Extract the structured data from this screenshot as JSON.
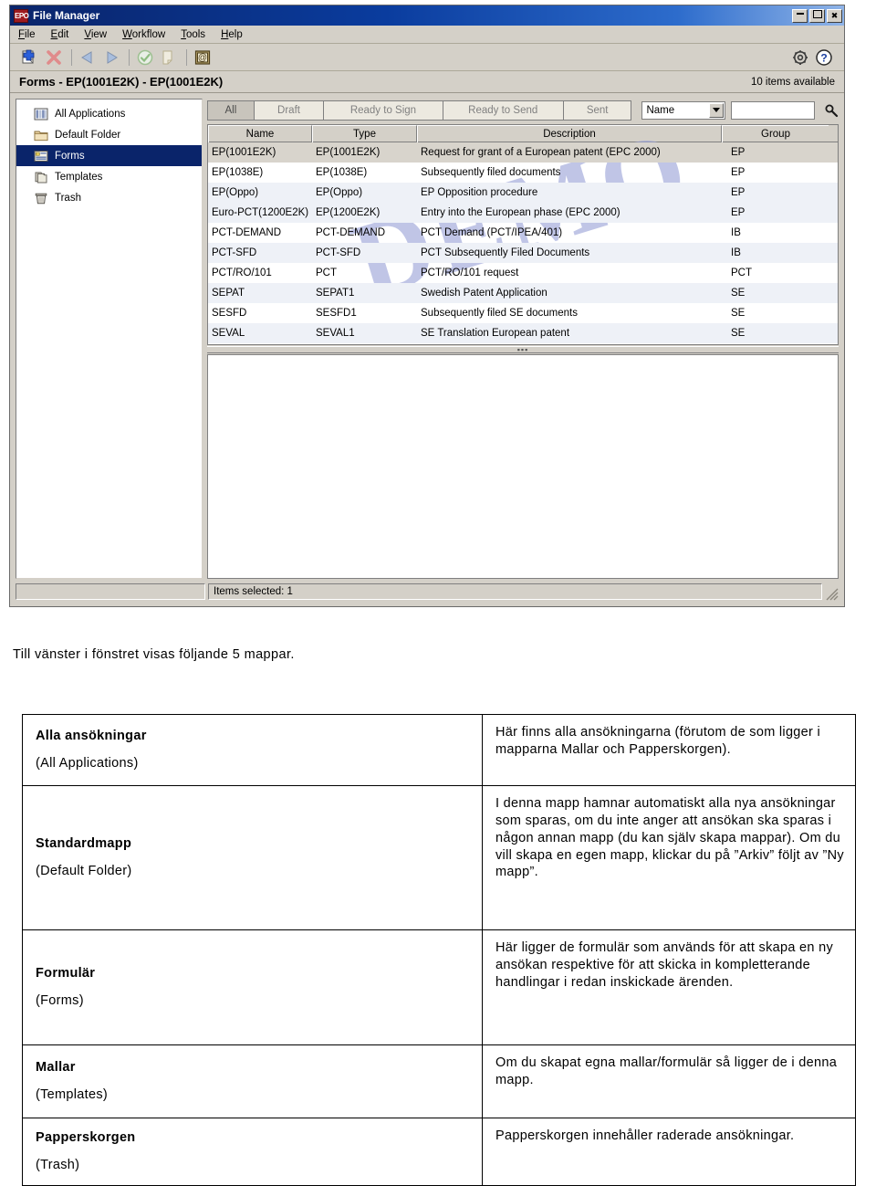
{
  "window": {
    "app_icon_label": "EPO",
    "title": "File Manager",
    "controls": {
      "minimize": "_",
      "maximize": "□",
      "close": "✕"
    },
    "menu": [
      "File",
      "Edit",
      "View",
      "Workflow",
      "Tools",
      "Help"
    ],
    "toolbar_icons": [
      "new-document-icon",
      "delete-icon",
      "back-arrow-icon",
      "forward-arrow-icon",
      "validate-check-icon",
      "page-icon",
      "email-icon",
      "settings-gear-icon",
      "help-question-icon"
    ],
    "path": "Forms - EP(1001E2K) - EP(1001E2K)",
    "items_available": "10 items available",
    "status_left": "",
    "status_right": "Items selected: 1"
  },
  "tree": {
    "items": [
      {
        "label": "All Applications",
        "icon": "columns-icon",
        "selected": false
      },
      {
        "label": "Default Folder",
        "icon": "folder-icon",
        "selected": false
      },
      {
        "label": "Forms",
        "icon": "forms-icon",
        "selected": true
      },
      {
        "label": "Templates",
        "icon": "templates-icon",
        "selected": false
      },
      {
        "label": "Trash",
        "icon": "trash-icon",
        "selected": false
      }
    ]
  },
  "filters": {
    "tabs": [
      {
        "label": "All",
        "active": true
      },
      {
        "label": "Draft",
        "active": false
      },
      {
        "label": "Ready to Sign",
        "active": false
      },
      {
        "label": "Ready to Send",
        "active": false
      },
      {
        "label": "Sent",
        "active": false
      }
    ],
    "select_value": "Name",
    "search_value": "",
    "search_icon": "magnifier-icon"
  },
  "grid": {
    "columns": [
      "Name",
      "Type",
      "Description",
      "Group"
    ],
    "watermark": "DEMO",
    "rows": [
      {
        "name": "EP(1001E2K)",
        "type": "EP(1001E2K)",
        "description": "Request for grant of a European patent (EPC 2000)",
        "group": "EP"
      },
      {
        "name": "EP(1038E)",
        "type": "EP(1038E)",
        "description": "Subsequently filed documents",
        "group": "EP"
      },
      {
        "name": "EP(Oppo)",
        "type": "EP(Oppo)",
        "description": "EP Opposition procedure",
        "group": "EP"
      },
      {
        "name": "Euro-PCT(1200E2K)",
        "type": "EP(1200E2K)",
        "description": "Entry into the European phase (EPC 2000)",
        "group": "EP"
      },
      {
        "name": "PCT-DEMAND",
        "type": "PCT-DEMAND",
        "description": "PCT Demand (PCT/IPEA/401)",
        "group": "IB"
      },
      {
        "name": "PCT-SFD",
        "type": "PCT-SFD",
        "description": "PCT Subsequently Filed Documents",
        "group": "IB"
      },
      {
        "name": "PCT/RO/101",
        "type": "PCT",
        "description": "PCT/RO/101 request",
        "group": "PCT"
      },
      {
        "name": "SEPAT",
        "type": "SEPAT1",
        "description": "Swedish Patent Application",
        "group": "SE"
      },
      {
        "name": "SESFD",
        "type": "SESFD1",
        "description": "Subsequently filed SE documents",
        "group": "SE"
      },
      {
        "name": "SEVAL",
        "type": "SEVAL1",
        "description": "SE Translation European patent",
        "group": "SE"
      }
    ]
  },
  "doc": {
    "caption": "Till vänster i fönstret visas följande 5 mappar.",
    "folders": [
      {
        "name_sv": "Alla ansökningar",
        "name_en": "(All Applications)",
        "description": "Här finns alla ansökningarna (förutom de som ligger i mapparna Mallar och Papperskorgen)."
      },
      {
        "name_sv": "Standardmapp",
        "name_en": "(Default Folder)",
        "description": "I denna mapp hamnar automatiskt alla nya ansökningar som sparas, om du inte anger att ansökan ska sparas i någon annan mapp (du kan själv skapa mappar). Om du vill skapa en egen mapp, klickar du på ”Arkiv” följt av ”Ny mapp”."
      },
      {
        "name_sv": "Formulär",
        "name_en": "(Forms)",
        "description": "Här ligger de formulär som används för att skapa en ny ansökan respektive för att skicka in kompletterande handlingar i redan inskickade ärenden."
      },
      {
        "name_sv": "Mallar",
        "name_en": "(Templates)",
        "description": "Om du skapat egna mallar/formulär så ligger de i denna mapp."
      },
      {
        "name_sv": "Papperskorgen",
        "name_en": "(Trash)",
        "description": "Papperskorgen innehåller raderade ansökningar."
      }
    ]
  },
  "colors": {
    "titlebar_start": "#0a246a",
    "titlebar_end": "#8fb4e8",
    "chrome": "#d4d0c8",
    "selection": "#0a246a",
    "watermark": "#9aa3d8",
    "alt_row": "#eef1f7"
  }
}
